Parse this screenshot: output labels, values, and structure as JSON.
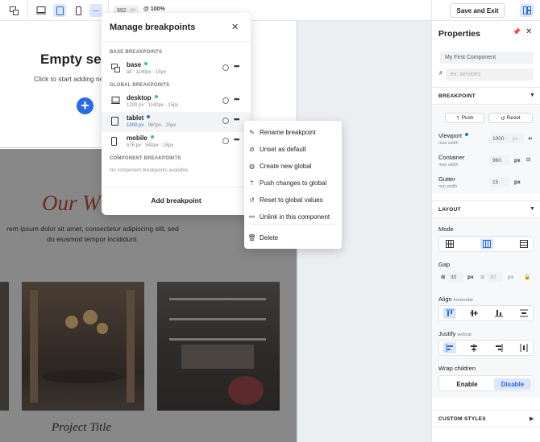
{
  "toolbar": {
    "viewport_width": "992",
    "viewport_unit": "px",
    "zoom": "@ 100%",
    "save_label": "Save and Exit"
  },
  "canvas": {
    "empty_title": "Empty sec",
    "empty_sub": "Click to start adding ne",
    "hero_title": "Our W",
    "lorem_line1": "rem ipsum dolor sit amet, consectetur adipiscing elit, sed",
    "lorem_line2": "do eiusmod tempor incididunt.",
    "project_title": "Project Title"
  },
  "modal": {
    "title": "Manage breakpoints",
    "base_section": "BASE BREAKPOINTS",
    "global_section": "GLOBAL BREAKPOINTS",
    "component_section": "COMPONENT BREAKPOINTS",
    "no_component": "No component breakpoints available.",
    "add_label": "Add breakpoint",
    "breakpoints": [
      {
        "name": "base",
        "meta_a": "all",
        "meta_b": "1140px",
        "meta_c": "15px",
        "dot": "#3ec46d"
      },
      {
        "name": "desktop",
        "meta_a": "1200 px",
        "meta_b": "1140px",
        "meta_c": "15px",
        "dot": "#3ec46d"
      },
      {
        "name": "tablet",
        "meta_a": "1000 px",
        "meta_b": "960px",
        "meta_c": "15px",
        "dot": "#2b6be0"
      },
      {
        "name": "mobile",
        "meta_a": "576 px",
        "meta_b": "540px",
        "meta_c": "15px",
        "dot": "#3ec46d"
      }
    ]
  },
  "context_menu": {
    "items": [
      {
        "label": "Rename breakpoint",
        "icon": "pencil-icon"
      },
      {
        "label": "Unset as default",
        "icon": "unset-icon"
      },
      {
        "label": "Create new global",
        "icon": "globe-icon"
      },
      {
        "label": "Push changes to global",
        "icon": "push-icon"
      },
      {
        "label": "Reset to global values",
        "icon": "reset-icon"
      },
      {
        "label": "Unlink in this component",
        "icon": "unlink-icon"
      },
      {
        "label": "Delete",
        "icon": "trash-icon"
      }
    ]
  },
  "properties": {
    "title": "Properties",
    "component_name": "My First Component",
    "class_placeholder": "ex: services",
    "breakpoint_section": "BREAKPOINT",
    "push_label": "Push",
    "reset_label": "Reset",
    "viewport_label": "Viewport",
    "viewport_sub": "max width",
    "viewport_value": "1000",
    "viewport_unit": "px",
    "container_label": "Container",
    "container_sub": "max width",
    "container_value": "960",
    "container_unit": "px",
    "gutter_label": "Gutter",
    "gutter_sub": "min width",
    "gutter_value": "15",
    "gutter_unit": "px",
    "layout_section": "LAYOUT",
    "mode_label": "Mode",
    "gap_label": "Gap",
    "gap_x": "30",
    "gap_x_unit": "px",
    "gap_y": "30",
    "gap_y_unit": "px",
    "align_label": "Align",
    "align_sub": "horizontal",
    "justify_label": "Justify",
    "justify_sub": "vertical",
    "wrap_label": "Wrap children",
    "enable_label": "Enable",
    "disable_label": "Disable",
    "custom_styles_section": "CUSTOM STYLES"
  },
  "colors": {
    "accent": "#2b6be0",
    "active_bg": "#dbe6fa",
    "hero_title": "#6b2a22"
  }
}
